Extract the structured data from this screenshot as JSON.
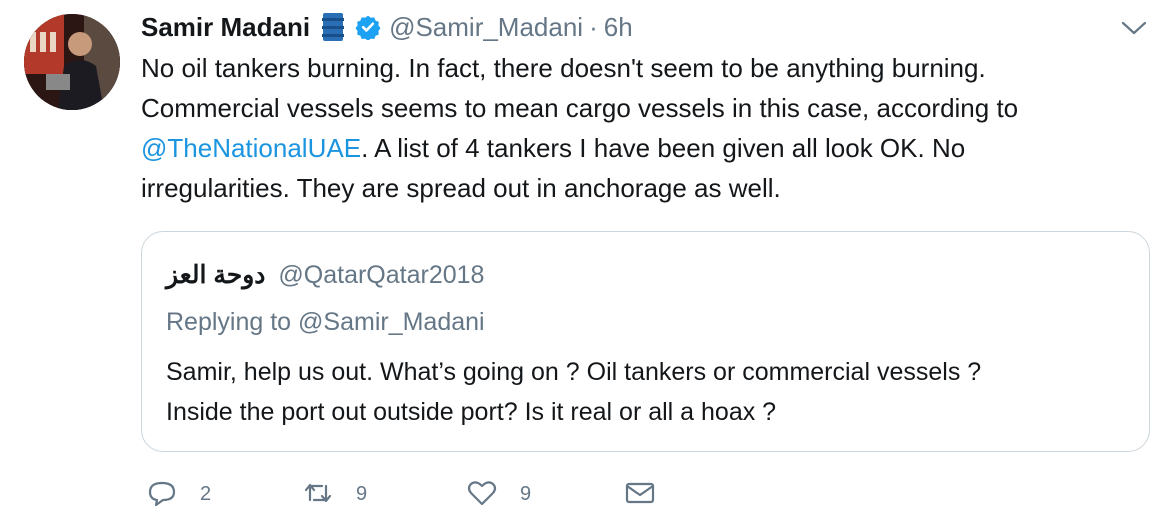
{
  "author": {
    "name": "Samir Madani",
    "handle": "@Samir_Madani",
    "time_sep": "·",
    "time": "6h"
  },
  "tweet": {
    "line1": "No oil tankers burning. In fact, there doesn't seem to be anything burning.",
    "line2": "Commercial vessels seems to mean cargo vessels in this case, according to",
    "mention": "@TheNationalUAE",
    "line3_rest": ". A list of 4 tankers I have been given all look OK. No",
    "line4": "irregularities. They are spread out in anchorage as well."
  },
  "quoted": {
    "name": "دوحة العز",
    "handle": "@QatarQatar2018",
    "reply_prefix": "Replying to",
    "reply_to": "@Samir_Madani",
    "line1": "Samir, help us out.  What’s going on ? Oil tankers or commercial vessels ?",
    "line2": "Inside the port out outside port? Is it real or all a hoax ?"
  },
  "actions": {
    "reply_count": "2",
    "retweet_count": "9",
    "like_count": "9"
  },
  "colors": {
    "link": "#1b95e0",
    "secondary": "#657786",
    "verified": "#1da1f2",
    "border": "#ccd6dd"
  },
  "icons": [
    "barrel-icon",
    "verified-badge-icon",
    "chevron-down-icon",
    "reply-icon",
    "retweet-icon",
    "like-icon",
    "message-icon"
  ]
}
